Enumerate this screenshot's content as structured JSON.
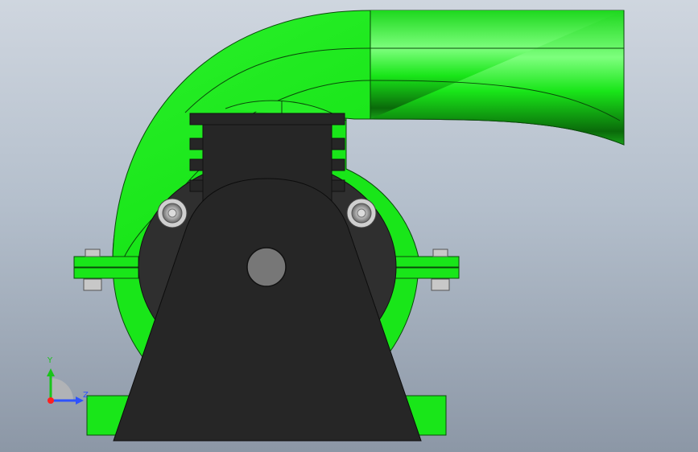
{
  "viewport": {
    "background_top": "#cfd6df",
    "background_bottom": "#8c97a6"
  },
  "model": {
    "body_color": "#19e619",
    "body_highlight": "#7dff7d",
    "body_shadow": "#0a6a0a",
    "casing_color": "#2f2f2f",
    "bracket_color": "#262626",
    "bolt_color": "#c8c8c8",
    "shaft_color": "#777777"
  },
  "triad": {
    "y_label": "Y",
    "z_label": "Z",
    "y_color": "#19c419",
    "z_color": "#2d52ff",
    "x_color": "#ff2020"
  }
}
